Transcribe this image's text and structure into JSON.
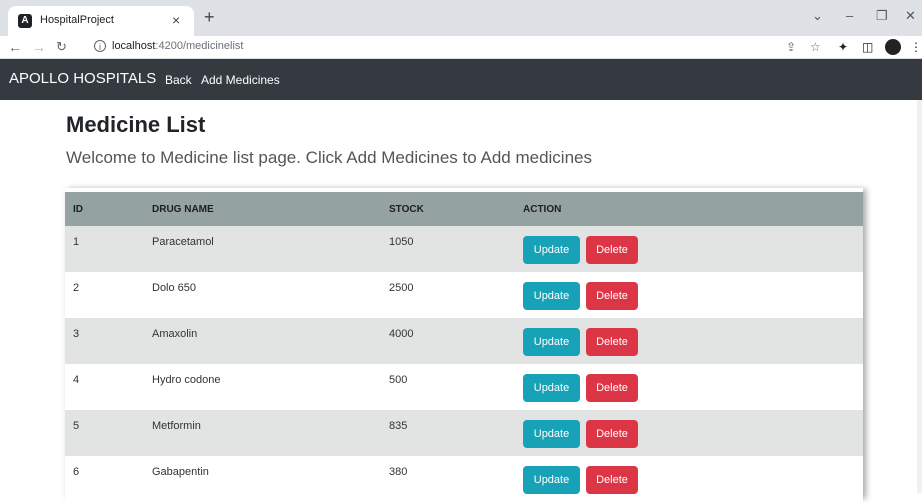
{
  "browser": {
    "tab_title": "HospitalProject",
    "favicon_letter": "A",
    "url_host": "localhost",
    "url_rest": ":4200/medicinelist"
  },
  "navbar": {
    "brand": "APOLLO HOSPITALS",
    "links": [
      "Back",
      "Add Medicines"
    ],
    "background": "#343a40"
  },
  "main": {
    "title": "Medicine List",
    "welcome": "Welcome to Medicine list page. Click Add Medicines to Add medicines"
  },
  "table": {
    "headers": [
      "ID",
      "DRUG NAME",
      "STOCK",
      "ACTION"
    ],
    "rows": [
      {
        "id": "1",
        "name": "Paracetamol",
        "stock": "1050"
      },
      {
        "id": "2",
        "name": "Dolo 650",
        "stock": "2500"
      },
      {
        "id": "3",
        "name": "Amaxolin",
        "stock": "4000"
      },
      {
        "id": "4",
        "name": "Hydro codone",
        "stock": "500"
      },
      {
        "id": "5",
        "name": "Metformin",
        "stock": "835"
      },
      {
        "id": "6",
        "name": "Gabapentin",
        "stock": "380"
      }
    ],
    "update_label": "Update",
    "delete_label": "Delete",
    "header_color": "#95a3a0",
    "update_color": "#17a2b8",
    "delete_color": "#dc3545"
  }
}
